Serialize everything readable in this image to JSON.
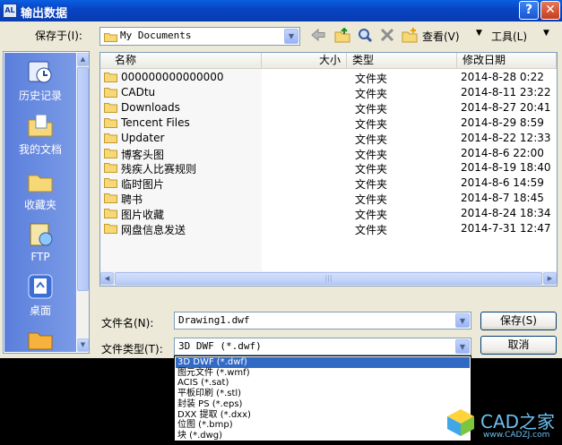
{
  "titlebar": {
    "title": "输出数据",
    "app_icon_label": "AL",
    "help_label": "?",
    "close_label": "✕"
  },
  "save_in": {
    "label": "保存于(I):",
    "value": "My Documents"
  },
  "toolbar": {
    "view_label": "查看(V)",
    "tools_label": "工具(L)"
  },
  "places": [
    {
      "label": "历史记录",
      "icon": "history-icon"
    },
    {
      "label": "我的文档",
      "icon": "my-documents-icon"
    },
    {
      "label": "收藏夹",
      "icon": "favorites-icon"
    },
    {
      "label": "FTP",
      "icon": "ftp-icon"
    },
    {
      "label": "桌面",
      "icon": "desktop-icon"
    }
  ],
  "columns": {
    "name": "名称",
    "size": "大小",
    "type": "类型",
    "modified": "修改日期"
  },
  "files": [
    {
      "name": "000000000000000",
      "type": "文件夹",
      "date": "2014-8-28 0:22"
    },
    {
      "name": "CADtu",
      "type": "文件夹",
      "date": "2014-8-11 23:22"
    },
    {
      "name": "Downloads",
      "type": "文件夹",
      "date": "2014-8-27 20:41"
    },
    {
      "name": "Tencent Files",
      "type": "文件夹",
      "date": "2014-8-29 8:59"
    },
    {
      "name": "Updater",
      "type": "文件夹",
      "date": "2014-8-22 12:33"
    },
    {
      "name": "博客头图",
      "type": "文件夹",
      "date": "2014-8-6 22:00"
    },
    {
      "name": "残疾人比赛规则",
      "type": "文件夹",
      "date": "2014-8-19 18:40"
    },
    {
      "name": "临时图片",
      "type": "文件夹",
      "date": "2014-8-6 14:59"
    },
    {
      "name": "聘书",
      "type": "文件夹",
      "date": "2014-8-7 18:45"
    },
    {
      "name": "图片收藏",
      "type": "文件夹",
      "date": "2014-8-24 18:34"
    },
    {
      "name": "网盘信息发送",
      "type": "文件夹",
      "date": "2014-7-31 12:47"
    }
  ],
  "filename": {
    "label": "文件名(N):",
    "value": "Drawing1.dwf"
  },
  "filetype": {
    "label": "文件类型(T):",
    "value": "3D DWF (*.dwf)",
    "options": [
      "3D DWF (*.dwf)",
      "图元文件 (*.wmf)",
      "ACIS (*.sat)",
      "平板印刷 (*.stl)",
      "封装 PS (*.eps)",
      "DXX 提取 (*.dxx)",
      "位图 (*.bmp)",
      "块 (*.dwg)"
    ]
  },
  "buttons": {
    "save": "保存(S)",
    "cancel": "取消"
  },
  "watermark": {
    "name": "CAD之家",
    "url": "www.CADZJ.com"
  }
}
